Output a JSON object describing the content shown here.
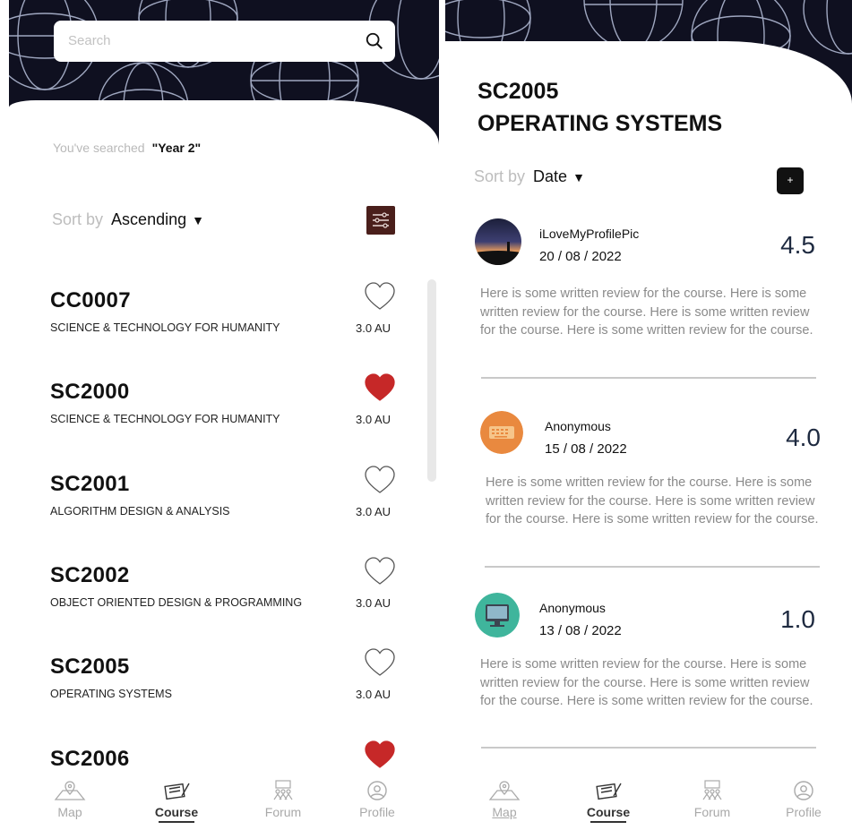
{
  "left": {
    "search": {
      "placeholder": "Search"
    },
    "searched": {
      "prefix": "You've searched",
      "query": "\"Year 2\""
    },
    "sort": {
      "label": "Sort by",
      "value": "Ascending"
    },
    "courses": [
      {
        "code": "CC0007",
        "name": "SCIENCE & TECHNOLOGY FOR HUMANITY",
        "au": "3.0 AU",
        "favorite": false
      },
      {
        "code": "SC2000",
        "name": "SCIENCE & TECHNOLOGY FOR HUMANITY",
        "au": "3.0 AU",
        "favorite": true
      },
      {
        "code": "SC2001",
        "name": "ALGORITHM DESIGN & ANALYSIS",
        "au": "3.0 AU",
        "favorite": false
      },
      {
        "code": "SC2002",
        "name": "OBJECT ORIENTED DESIGN & PROGRAMMING",
        "au": "3.0 AU",
        "favorite": false
      },
      {
        "code": "SC2005",
        "name": "OPERATING SYSTEMS",
        "au": "3.0 AU",
        "favorite": false
      },
      {
        "code": "SC2006",
        "name": "",
        "au": "",
        "favorite": true
      }
    ]
  },
  "right": {
    "course_code": "SC2005",
    "course_title": "OPERATING SYSTEMS",
    "sort": {
      "label": "Sort by",
      "value": "Date"
    },
    "add_label": "+",
    "reviews": [
      {
        "user": "iLoveMyProfilePic",
        "date": "20 / 08 / 2022",
        "score": "4.5",
        "avatar": "sunset-photo",
        "text": "Here is some written review for the course. Here is some written review for the course. Here is some written review for the course. Here is some written review for the course."
      },
      {
        "user": "Anonymous",
        "date": "15 / 08 / 2022",
        "score": "4.0",
        "avatar": "keyboard-icon",
        "text": "Here is some written review for the course. Here is some written review for the course. Here is some written review for the course. Here is some written review for the course."
      },
      {
        "user": "Anonymous",
        "date": "13 / 08 / 2022",
        "score": "1.0",
        "avatar": "monitor-icon",
        "text": "Here is some written review for the course. Here is some written review for the course. Here is some written review for the course. Here is some written review for the course."
      }
    ]
  },
  "nav": [
    {
      "label": "Map",
      "icon": "map-icon"
    },
    {
      "label": "Course",
      "icon": "course-icon",
      "active": true
    },
    {
      "label": "Forum",
      "icon": "forum-icon"
    },
    {
      "label": "Profile",
      "icon": "profile-icon"
    }
  ],
  "colors": {
    "heart_filled": "#c62828",
    "filter_btn": "#4a1f1b",
    "header_bg": "#0f1020",
    "keyboard_avatar": "#e9893f",
    "monitor_avatar": "#3fb59c"
  }
}
